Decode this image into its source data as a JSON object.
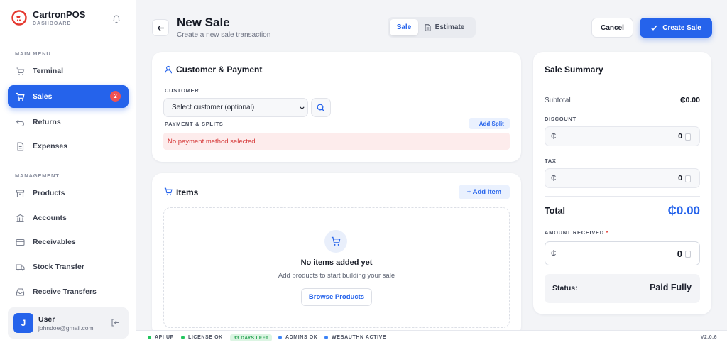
{
  "brand": {
    "name": "CartronPOS",
    "subtitle": "DASHBOARD"
  },
  "sidebar": {
    "main_menu_label": "MAIN MENU",
    "management_label": "MANAGEMENT",
    "main_items": [
      {
        "label": "Terminal",
        "icon": "terminal-icon"
      },
      {
        "label": "Sales",
        "icon": "cart-icon",
        "active": true,
        "badge": "2"
      },
      {
        "label": "Returns",
        "icon": "return-icon"
      },
      {
        "label": "Expenses",
        "icon": "document-icon"
      }
    ],
    "management_items": [
      {
        "label": "Products",
        "icon": "box-icon"
      },
      {
        "label": "Accounts",
        "icon": "bank-icon"
      },
      {
        "label": "Receivables",
        "icon": "card-icon"
      },
      {
        "label": "Stock Transfer",
        "icon": "truck-icon"
      },
      {
        "label": "Receive Transfers",
        "icon": "inbox-icon"
      }
    ],
    "user": {
      "initial": "J",
      "name": "User",
      "email": "johndoe@gmail.com"
    }
  },
  "header": {
    "title": "New Sale",
    "subtitle": "Create a new sale transaction",
    "tabs": {
      "sale": "Sale",
      "estimate": "Estimate"
    },
    "cancel_label": "Cancel",
    "create_label": "Create Sale"
  },
  "customer_card": {
    "title": "Customer & Payment",
    "customer_label": "CUSTOMER",
    "select_value": "Select customer (optional)",
    "payments_label": "PAYMENT & SPLITS",
    "add_split_label": "+ Add Split",
    "alert": "No payment method selected."
  },
  "items_card": {
    "title": "Items",
    "add_item_label": "+ Add Item",
    "empty_title": "No items added yet",
    "empty_sub": "Add products to start building your sale",
    "browse_label": "Browse Products"
  },
  "summary": {
    "title": "Sale Summary",
    "subtotal_label": "Subtotal",
    "subtotal_value": "₵0.00",
    "discount_label": "DISCOUNT",
    "discount_currency": "₵",
    "discount_value": "0",
    "tax_label": "TAX",
    "tax_currency": "₵",
    "tax_value": "0",
    "total_label": "Total",
    "total_value": "₵0.00",
    "received_label": "AMOUNT RECEIVED",
    "received_required": "*",
    "received_currency": "₵",
    "received_value": "0",
    "status_label": "Status:",
    "status_value": "Paid Fully"
  },
  "footer": {
    "api": "API UP",
    "license": "LICENSE OK",
    "days_left": "33 DAYS LEFT",
    "admins": "ADMINS OK",
    "webauthn": "WEBAUTHN ACTIVE",
    "version": "V2.0.6"
  },
  "colors": {
    "accent": "#2563eb",
    "danger": "#f05252",
    "success": "#22c55e"
  }
}
